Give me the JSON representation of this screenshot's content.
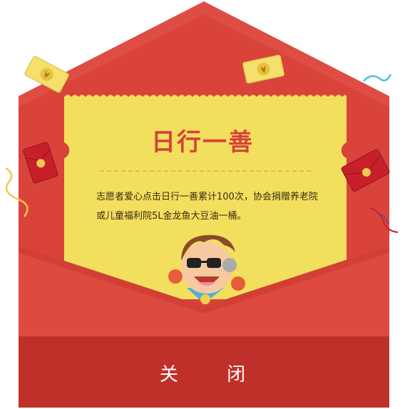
{
  "card": {
    "title": "日行一善",
    "message": "志愿者爱心点击日行一善累计100次，协会捐赠养老院或儿童福利院5L金龙鱼大豆油一桶。"
  },
  "footer": {
    "close_label": "关 闭"
  },
  "decorations": {
    "envelope_icon_symbol": "¥",
    "tag_symbol": "¥"
  },
  "colors": {
    "envelope_red": "#d9433a",
    "envelope_dark": "#c0302a",
    "card_yellow": "#f2df5e",
    "title_red": "#d6423a"
  }
}
